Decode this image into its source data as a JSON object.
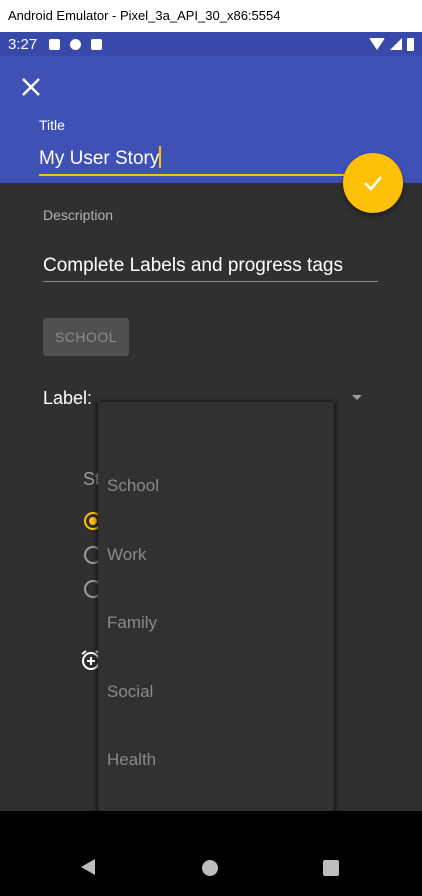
{
  "emulator": {
    "title": "Android Emulator - Pixel_3a_API_30_x86:5554"
  },
  "status_bar": {
    "time": "3:27",
    "icons": [
      "a-notification-icon",
      "p-notification-icon",
      "sd-card-icon"
    ],
    "right_icons": [
      "wifi-icon",
      "signal-icon",
      "battery-icon"
    ]
  },
  "app_bar": {
    "close_icon": "close-icon",
    "title_label": "Title",
    "title_value": "My User Story"
  },
  "fab": {
    "icon": "check-icon",
    "color": "#ffc107"
  },
  "form": {
    "description_label": "Description",
    "description_value": "Complete Labels and progress tags",
    "chip_label": "SCHOOL",
    "label_field": "Label:",
    "status_partial": "St"
  },
  "dropdown": {
    "options": [
      "School",
      "Work",
      "Family",
      "Social",
      "Health"
    ]
  },
  "colors": {
    "primary": "#3f51b5",
    "status_bar": "#3849a9",
    "accent": "#ffc107",
    "background": "#303030"
  }
}
